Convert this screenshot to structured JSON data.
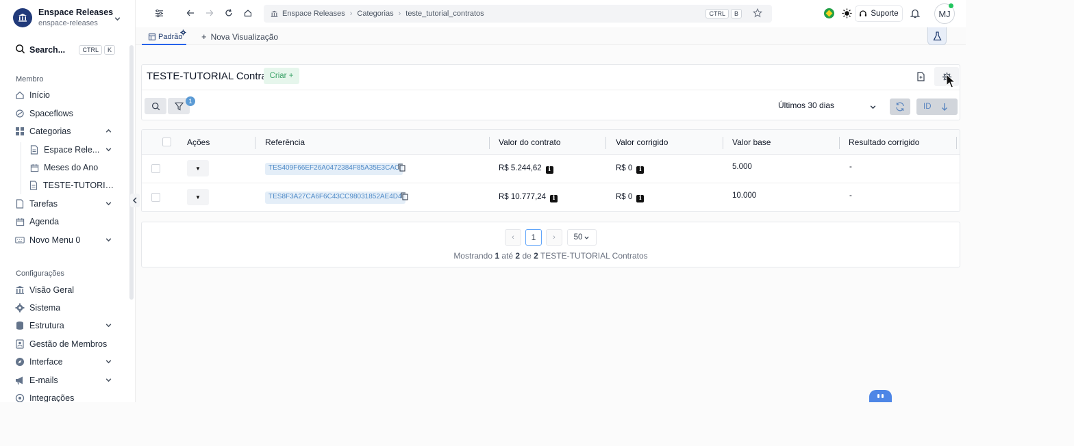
{
  "org": {
    "name": "Enspace Releases",
    "slug": "enspace-releases"
  },
  "search": {
    "label": "Search...",
    "keys": [
      "CTRL",
      "K"
    ]
  },
  "sidebar": {
    "section_member": "Membro",
    "items": [
      {
        "label": "Início",
        "icon": "home-icon"
      },
      {
        "label": "Spaceflows",
        "icon": "spaceflows-icon"
      },
      {
        "label": "Categorias",
        "icon": "grid-icon",
        "expanded": true
      },
      {
        "label": "Espace Rele...",
        "icon": "document-icon"
      },
      {
        "label": "Meses do Ano",
        "icon": "calendar-icon"
      },
      {
        "label": "TESTE-TUTORIAL ...",
        "icon": "document-icon"
      },
      {
        "label": "Tarefas",
        "icon": "file-icon"
      },
      {
        "label": "Agenda",
        "icon": "calendar-icon"
      },
      {
        "label": "Novo Menu 0",
        "icon": "keyboard-icon"
      }
    ],
    "section_config": "Configurações",
    "config_items": [
      {
        "label": "Visão Geral",
        "icon": "building-icon"
      },
      {
        "label": "Sistema",
        "icon": "gear-icon"
      },
      {
        "label": "Estrutura",
        "icon": "database-icon"
      },
      {
        "label": "Gestão de Membros",
        "icon": "member-card-icon"
      },
      {
        "label": "Interface",
        "icon": "compass-icon"
      },
      {
        "label": "E-mails",
        "icon": "megaphone-icon"
      },
      {
        "label": "Integrações",
        "icon": "integration-icon"
      }
    ]
  },
  "topbar": {
    "breadcrumb": [
      "Enspace Releases",
      "Categorias",
      "teste_tutorial_contratos"
    ],
    "keys": [
      "CTRL",
      "B"
    ],
    "support_label": "Suporte",
    "avatar_initials": "MJ"
  },
  "views": {
    "active": "Padrão",
    "new": "Nova Visualização"
  },
  "list": {
    "title": "TESTE-TUTORIAL Contratos",
    "create_label": "Criar +",
    "filter_count": "1",
    "period": "Últimos 30 dias",
    "sort_field": "ID"
  },
  "table": {
    "columns": [
      "Ações",
      "Referência",
      "Valor do contrato",
      "Valor corrigido",
      "Valor base",
      "Resultado corrigido"
    ],
    "rows": [
      {
        "ref": "TES409F66EF26A0472384F85A35E3CAC",
        "contract": "R$ 5.244,62",
        "corrected": "R$ 0",
        "base": "5.000",
        "result": "-"
      },
      {
        "ref": "TES8F3A27CA6F6C43CC98031852AE4D4",
        "contract": "R$ 10.777,24",
        "corrected": "R$ 0",
        "base": "10.000",
        "result": "-"
      }
    ]
  },
  "pager": {
    "current": "1",
    "page_size": "50",
    "info_prefix": "Mostrando",
    "from": "1",
    "to_word": "até",
    "to": "2",
    "of_word": "de",
    "total": "2",
    "entity": "TESTE-TUTORIAL Contratos"
  },
  "colors": {
    "brand": "#213a7a",
    "accent": "#2563eb",
    "create_bg": "#e6f6ec",
    "create_fg": "#3aa267",
    "ref_chip": "#e4eef8"
  }
}
